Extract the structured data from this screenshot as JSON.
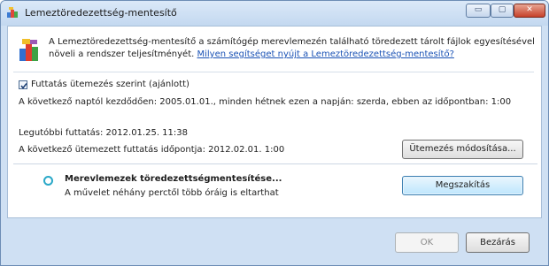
{
  "window": {
    "title": "Lemeztöredezettség-mentesítő",
    "controls": {
      "minimize": "▭",
      "maximize": "▢",
      "close": "✕"
    }
  },
  "description": {
    "text": "A Lemeztöredezettség-mentesítő a számítógép merevlemezén található töredezett tárolt fájlok egyesítésével növeli a rendszer teljesítményét.",
    "link": "Milyen segítséget nyújt a Lemeztöredezettség-mentesítő?"
  },
  "schedule": {
    "checkbox_label": "Futtatás ütemezés szerint (ajánlott)",
    "checked": true,
    "schedule_text": "A következő naptól kezdődően: 2005.01.01., minden hétnek ezen a napján: szerda, ebben az időpontban: 1:00",
    "last_run": "Legutóbbi futtatás: 2012.01.25. 11:38",
    "next_run": "A következő ütemezett futtatás időpontja: 2012.02.01. 1:00",
    "modify_button": "Ütemezés módosítása..."
  },
  "task": {
    "title": "Merevlemezek töredezettségmentesítése...",
    "subtitle": "A művelet néhány perctől több óráig is eltarthat",
    "stop_button": "Megszakítás"
  },
  "footer": {
    "ok_label": "OK",
    "close_label": "Bezárás"
  },
  "colors": {
    "link": "#1a52b5",
    "spinner": "#2aa8c8",
    "frame": "#cfe0f3"
  }
}
